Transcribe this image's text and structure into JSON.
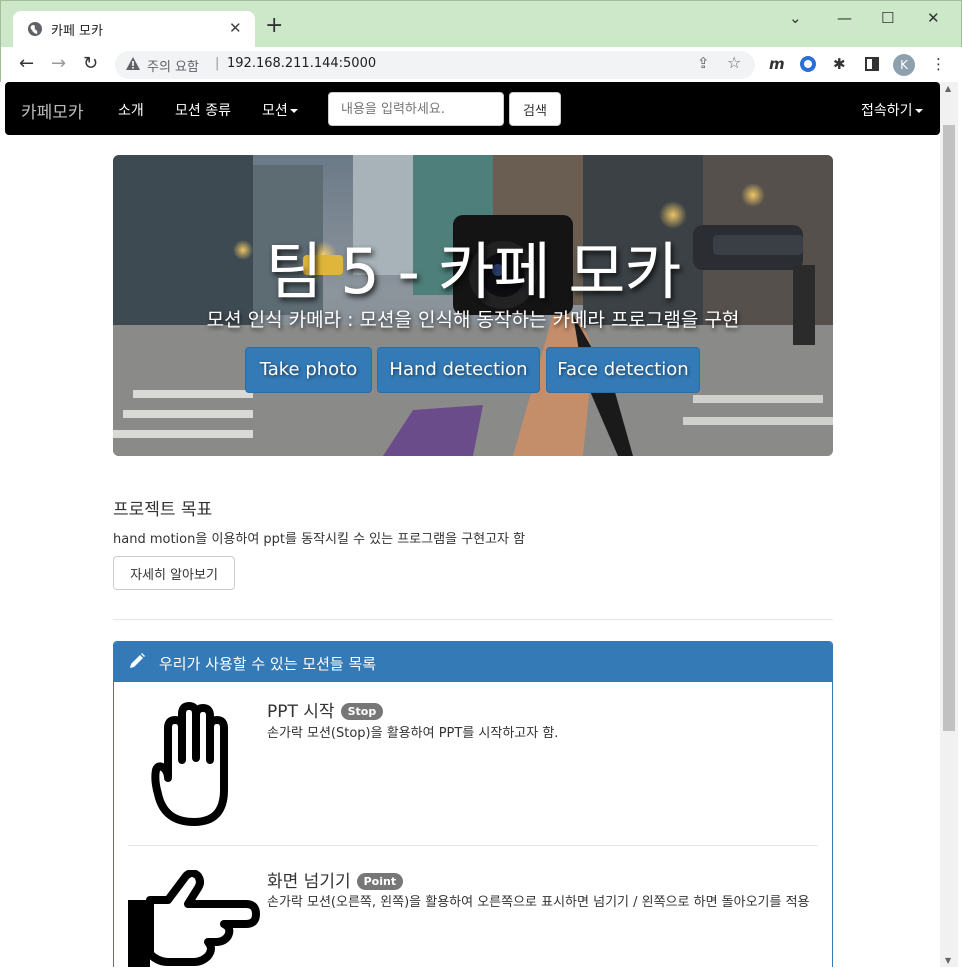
{
  "browser": {
    "tab_title": "카페 모카",
    "security_label": "주의 요함",
    "url": "192.168.211.144:5000",
    "profile_initial": "K"
  },
  "navbar": {
    "brand": "카페모카",
    "links": [
      "소개",
      "모션 종류",
      "모션"
    ],
    "search_placeholder": "내용을 입력하세요.",
    "search_button": "검색",
    "connect": "접속하기"
  },
  "hero": {
    "title": "팀 5 - 카페 모카",
    "subtitle": "모션 인식 카메라 : 모션을 인식해 동작하는 카메라 프로그램을 구현",
    "buttons": [
      "Take photo",
      "Hand detection",
      "Face detection"
    ]
  },
  "goal": {
    "title": "프로젝트 목표",
    "description": "hand motion을 이용하여 ppt를 동작시킬 수 있는 프로그램을 구현고자 함",
    "button": "자세히 알아보기"
  },
  "motions_panel": {
    "title": "우리가 사용할 수 있는 모션들 목록",
    "items": [
      {
        "title": "PPT 시작",
        "badge": "Stop",
        "description": "손가락 모션(Stop)을 활용하여 PPT를 시작하고자 함.",
        "icon": "open-hand-icon"
      },
      {
        "title": "화면 넘기기",
        "badge": "Point",
        "description": "손가락 모션(오른쪽, 왼쪽)을 활용하여 오른쪽으로 표시하면 넘기기 / 왼쪽으로 하면 돌아오기를 적용",
        "icon": "pointing-hand-icon"
      }
    ]
  },
  "colors": {
    "primary": "#337ab7",
    "navbar_bg": "#000000",
    "badge": "#777777",
    "chrome_frame": "#cde8c9"
  }
}
